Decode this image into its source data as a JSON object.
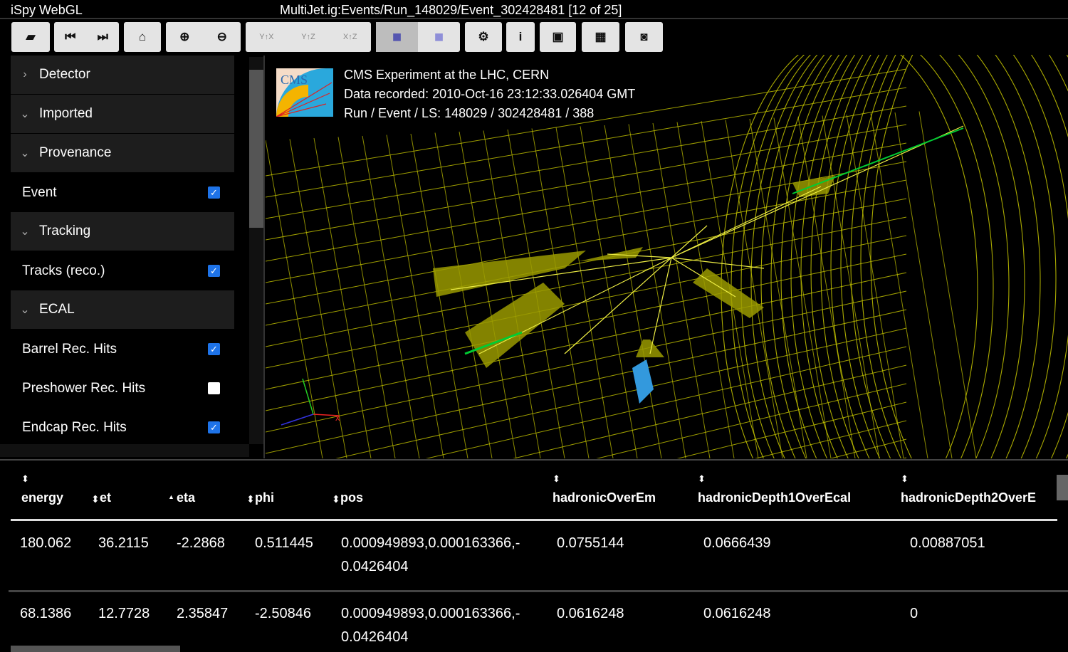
{
  "app_title": "iSpy WebGL",
  "event_title": "MultiJet.ig:Events/Run_148029/Event_302428481 [12 of 25]",
  "toolbar": [
    {
      "group": [
        {
          "icon": "folder-open-icon",
          "glyph": "▰"
        }
      ]
    },
    {
      "group": [
        {
          "icon": "step-backward-icon",
          "glyph": "⏮"
        },
        {
          "icon": "step-forward-icon",
          "glyph": "⏭"
        }
      ]
    },
    {
      "group": [
        {
          "icon": "home-icon",
          "glyph": "⌂"
        }
      ]
    },
    {
      "group": [
        {
          "icon": "zoom-in-icon",
          "glyph": "⊕"
        },
        {
          "icon": "zoom-out-icon",
          "glyph": "⊖"
        }
      ]
    },
    {
      "group": [
        {
          "icon": "view-xy-icon",
          "glyph": "Y↑X"
        },
        {
          "icon": "view-yz-icon",
          "glyph": "Y↑Z"
        },
        {
          "icon": "view-xz-icon",
          "glyph": "X↑Z"
        }
      ]
    },
    {
      "group": [
        {
          "icon": "perspective-cube-icon",
          "glyph": "■"
        },
        {
          "icon": "orthographic-cube-icon",
          "glyph": "■"
        }
      ]
    },
    {
      "group": [
        {
          "icon": "gear-icon",
          "glyph": "⚙"
        }
      ]
    },
    {
      "group": [
        {
          "icon": "info-icon",
          "glyph": "i"
        }
      ]
    },
    {
      "group": [
        {
          "icon": "export-image-icon",
          "glyph": "▣"
        }
      ]
    },
    {
      "group": [
        {
          "icon": "film-icon",
          "glyph": "▦"
        }
      ]
    },
    {
      "group": [
        {
          "icon": "binoculars-icon",
          "glyph": "◙"
        }
      ]
    }
  ],
  "sidebar": [
    {
      "label": "Detector",
      "type": "folder",
      "expanded": false
    },
    {
      "label": "Imported",
      "type": "folder",
      "expanded": true
    },
    {
      "label": "Provenance",
      "type": "folder",
      "expanded": true
    },
    {
      "label": "Event",
      "type": "item",
      "checked": true
    },
    {
      "label": "Tracking",
      "type": "folder",
      "expanded": true
    },
    {
      "label": "Tracks (reco.)",
      "type": "item",
      "checked": true
    },
    {
      "label": "ECAL",
      "type": "folder",
      "expanded": true
    },
    {
      "label": "Barrel Rec. Hits",
      "type": "item",
      "checked": true
    },
    {
      "label": "Preshower Rec. Hits",
      "type": "item",
      "checked": false
    },
    {
      "label": "Endcap Rec. Hits",
      "type": "item",
      "checked": true
    }
  ],
  "info": {
    "line1": "CMS Experiment at the LHC, CERN",
    "line2": "Data recorded: 2010-Oct-16 23:12:33.026404 GMT",
    "line3": "Run / Event / LS: 148029 / 302428481 / 388",
    "logo_text": "CMS"
  },
  "axes": {
    "x": "x"
  },
  "colors": {
    "detector": "#c8c800",
    "jets": "#9a9a00",
    "tracks": "#00cc33",
    "hcal": "#3399dd",
    "checkbox": "#1e73e8"
  },
  "table": {
    "columns": [
      {
        "label": "energy",
        "sort": "both"
      },
      {
        "label": "et",
        "sort": "both"
      },
      {
        "label": "eta",
        "sort": "asc"
      },
      {
        "label": "phi",
        "sort": "both"
      },
      {
        "label": "pos",
        "sort": "both"
      },
      {
        "label": "hadronicOverEm",
        "sort": "both"
      },
      {
        "label": "hadronicDepth1OverEcal",
        "sort": "both"
      },
      {
        "label": "hadronicDepth2OverE",
        "sort": "both"
      }
    ],
    "rows": [
      [
        "180.062",
        "36.2115",
        "-2.2868",
        "0.511445",
        "0.000949893,0.000163366,-",
        "0.0755144",
        "0.0666439",
        "0.00887051",
        "0.0426404"
      ],
      [
        "68.1386",
        "12.7728",
        "2.35847",
        "-2.50846",
        "0.000949893,0.000163366,-",
        "0.0616248",
        "0.0616248",
        "0",
        "0.0426404"
      ]
    ]
  }
}
